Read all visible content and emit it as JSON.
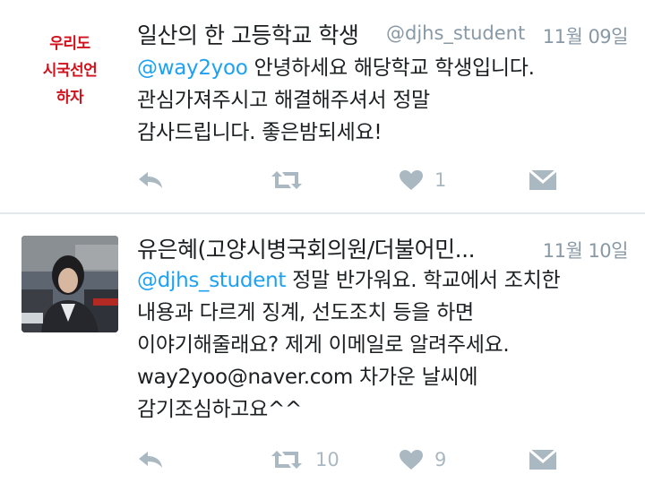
{
  "tweets": [
    {
      "avatar": {
        "alt": "우리도 시국선언 하자",
        "lines": [
          "우리도",
          "시국선언",
          "하자"
        ]
      },
      "name": "일산의 한 고등학교 학생",
      "handle": "@djhs_student",
      "date": "11월 09일",
      "mention": "@way2yoo",
      "lines": [
        " 안녕하세요 해당학교 학생입니다.",
        "관심가져주시고 해결해주셔서 정말",
        "감사드립니다. 좋은밤되세요!"
      ],
      "actions": {
        "reply_count": "",
        "retweet_count": "",
        "like_count": "1"
      }
    },
    {
      "name": "유은혜(고양시병국회의원/더불어민...",
      "handle": "",
      "date": "11월 10일",
      "mention": "@djhs_student",
      "lines": [
        " 정말 반가워요. 학교에서 조치한",
        "내용과 다르게 징계, 선도조치 등을 하면",
        "이야기해줄래요? 제게 이메일로 알려주세요.",
        "way2yoo@naver.com 차가운 날씨에",
        "감기조심하고요^^"
      ],
      "actions": {
        "reply_count": "",
        "retweet_count": "10",
        "like_count": "9"
      }
    }
  ],
  "colors": {
    "accent": "#1da1f2",
    "muted": "#aab8c2",
    "logo_red": "#d0121c"
  },
  "icons": [
    "reply-icon",
    "retweet-icon",
    "like-icon",
    "direct-message-icon"
  ]
}
